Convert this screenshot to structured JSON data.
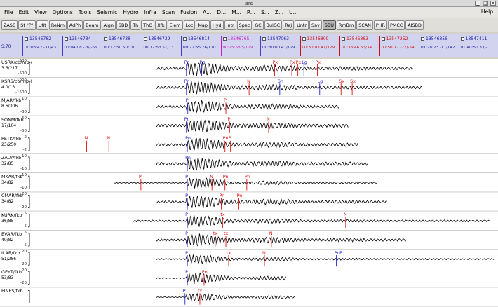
{
  "window": {
    "title": "ars"
  },
  "menu": [
    "File",
    "Edit",
    "View",
    "Options",
    "Tools",
    "Seismic",
    "Hydro",
    "Infra",
    "Scan",
    "Fusion",
    "A...",
    "D...",
    "M...",
    "R...",
    "S...",
    "Z...",
    "U..."
  ],
  "menu_help": "Help",
  "toolbar": [
    "ZASC",
    "St \"P\"",
    "Ufit",
    "ReNm",
    "AdPh",
    "Beam",
    "Algn",
    "SBD",
    "Th",
    "ThO",
    "Xfk",
    "Elem",
    "Loc",
    "Map",
    "Hyd",
    "Intr",
    "Spec",
    "GC",
    "BulGC",
    "Rej",
    "Untr",
    "Sav",
    "SBU",
    "RmBm",
    "SCAN",
    "PHR",
    "PMCC",
    "AISBD"
  ],
  "toolbar_active": "SBU",
  "event_strip": {
    "left_label": "S:70",
    "events": [
      {
        "id": "13546782",
        "time": "00:03:42 -31/43",
        "color": "blue"
      },
      {
        "id": "13546734",
        "time": "00:04:08 -26/-66",
        "color": "blue"
      },
      {
        "id": "13546738",
        "time": "00:12:50 50/10",
        "color": "blue"
      },
      {
        "id": "13546739",
        "time": "00:12:53 51/13",
        "color": "blue"
      },
      {
        "id": "13546814",
        "time": "00:22:55 76/110",
        "color": "blue"
      },
      {
        "id": "13546765",
        "time": "00:25:58 5/129",
        "color": "magenta"
      },
      {
        "id": "13547063",
        "time": "00:30:00 41/129",
        "color": "blue"
      },
      {
        "id": "13546809",
        "time": "00:30:03 41/129",
        "color": "red"
      },
      {
        "id": "13546863",
        "time": "00:38:46 53/34",
        "color": "red"
      },
      {
        "id": "13547252",
        "time": "00:50:17 -27/-54",
        "color": "red"
      },
      {
        "id": "13546856",
        "time": "01:28:23 -11/142",
        "color": "blue"
      },
      {
        "id": "13547411",
        "time": "01:40:50 33/-",
        "color": "blue"
      }
    ]
  },
  "channels": [
    {
      "name": "USRK/cb/mp-(",
      "sub": "3.6/217",
      "scale_top": "500",
      "scale_bot": "-500",
      "amp": 1.0,
      "start": 0.27,
      "noise": 0.18
    },
    {
      "name": "KSRS/cb/mp-(",
      "sub": "4.0/13",
      "scale_top": "1000",
      "scale_bot": "-1500",
      "amp": 0.9,
      "start": 0.27,
      "noise": 0.16
    },
    {
      "name": "MJAR/fkb",
      "sub": "8.6/306",
      "scale_top": "10",
      "scale_bot": "-30",
      "amp": 0.8,
      "start": 0.27,
      "noise": 0.15
    },
    {
      "name": "SONM/fkb",
      "sub": "17/104",
      "scale_top": "50",
      "scale_bot": "-50",
      "amp": 0.9,
      "start": 0.27,
      "noise": 0.18
    },
    {
      "name": "PETK/fkb",
      "sub": "23/250",
      "scale_top": "2",
      "scale_bot": "-2",
      "amp": 0.9,
      "start": 0.27,
      "noise": 0.15
    },
    {
      "name": "ZALV/fkb",
      "sub": "32/85",
      "scale_top": "10",
      "scale_bot": "-10",
      "amp": 0.8,
      "start": 0.27,
      "noise": 0.18
    },
    {
      "name": "MKAR/fkb",
      "sub": "34/82",
      "scale_top": "10",
      "scale_bot": "-10",
      "amp": 0.85,
      "start": 0.18,
      "noise": 0.06
    },
    {
      "name": "CMAR/fkb",
      "sub": "34/82",
      "scale_top": "20",
      "scale_bot": "-20",
      "amp": 0.9,
      "start": 0.27,
      "noise": 0.14
    },
    {
      "name": "KURK/fkb",
      "sub": "36/85",
      "scale_top": "5",
      "scale_bot": "-5",
      "amp": 0.8,
      "start": 0.22,
      "noise": 0.12
    },
    {
      "name": "BVAR/fkb",
      "sub": "40/82",
      "scale_top": "5",
      "scale_bot": "-5",
      "amp": 0.85,
      "start": 0.27,
      "noise": 0.16
    },
    {
      "name": "ILAR/fkb",
      "sub": "51/286",
      "scale_top": "20",
      "scale_bot": "-20",
      "amp": 0.7,
      "start": 0.27,
      "noise": 0.08
    },
    {
      "name": "GEYT/fkb",
      "sub": "53/83",
      "scale_top": "20",
      "scale_bot": "-20",
      "amp": 0.8,
      "start": 0.27,
      "noise": 0.07
    },
    {
      "name": "FINES/fkb",
      "sub": "",
      "scale_top": "",
      "scale_bot": "",
      "amp": 0.6,
      "start": 0.27,
      "noise": 0.05
    }
  ],
  "phases": [
    {
      "ch": 0,
      "label": "Pn",
      "t": 0.335,
      "color": "blue"
    },
    {
      "ch": 0,
      "label": "Pg",
      "t": 0.368,
      "color": "blue"
    },
    {
      "ch": 0,
      "label": "Px",
      "t": 0.525,
      "color": "red"
    },
    {
      "ch": 0,
      "label": "Px",
      "t": 0.562,
      "color": "red"
    },
    {
      "ch": 0,
      "label": "Px",
      "t": 0.575,
      "color": "red"
    },
    {
      "ch": 0,
      "label": "Lg",
      "t": 0.588,
      "color": "blue"
    },
    {
      "ch": 0,
      "label": "Px",
      "t": 0.617,
      "color": "red"
    },
    {
      "ch": 1,
      "label": "Pn",
      "t": 0.335,
      "color": "blue"
    },
    {
      "ch": 1,
      "label": "N",
      "t": 0.47,
      "color": "red"
    },
    {
      "ch": 1,
      "label": "Sn",
      "t": 0.536,
      "color": "blue"
    },
    {
      "ch": 1,
      "label": "Lg",
      "t": 0.622,
      "color": "blue"
    },
    {
      "ch": 1,
      "label": "Sx",
      "t": 0.668,
      "color": "red"
    },
    {
      "ch": 1,
      "label": "Sx",
      "t": 0.692,
      "color": "red"
    },
    {
      "ch": 2,
      "label": "P",
      "t": 0.338,
      "color": "blue"
    },
    {
      "ch": 2,
      "label": "P",
      "t": 0.42,
      "color": "red"
    },
    {
      "ch": 3,
      "label": "Pn",
      "t": 0.335,
      "color": "blue"
    },
    {
      "ch": 3,
      "label": "P",
      "t": 0.428,
      "color": "red"
    },
    {
      "ch": 3,
      "label": "N",
      "t": 0.512,
      "color": "red"
    },
    {
      "ch": 4,
      "label": "N",
      "t": 0.12,
      "color": "red"
    },
    {
      "ch": 4,
      "label": "N",
      "t": 0.168,
      "color": "red"
    },
    {
      "ch": 4,
      "label": "Pn",
      "t": 0.337,
      "color": "blue"
    },
    {
      "ch": 4,
      "label": "Pn",
      "t": 0.418,
      "color": "red"
    },
    {
      "ch": 4,
      "label": "P",
      "t": 0.43,
      "color": "red"
    },
    {
      "ch": 5,
      "label": "Pn",
      "t": 0.337,
      "color": "blue"
    },
    {
      "ch": 6,
      "label": "P",
      "t": 0.237,
      "color": "red"
    },
    {
      "ch": 6,
      "label": "P",
      "t": 0.337,
      "color": "blue"
    },
    {
      "ch": 6,
      "label": "N",
      "t": 0.39,
      "color": "red"
    },
    {
      "ch": 6,
      "label": "Pn",
      "t": 0.418,
      "color": "red"
    },
    {
      "ch": 6,
      "label": "Pn",
      "t": 0.465,
      "color": "red"
    },
    {
      "ch": 7,
      "label": "P",
      "t": 0.337,
      "color": "blue"
    },
    {
      "ch": 7,
      "label": "Pn",
      "t": 0.41,
      "color": "red"
    },
    {
      "ch": 7,
      "label": "Pn",
      "t": 0.448,
      "color": "red"
    },
    {
      "ch": 8,
      "label": "P",
      "t": 0.337,
      "color": "blue"
    },
    {
      "ch": 8,
      "label": "tx",
      "t": 0.413,
      "color": "red"
    },
    {
      "ch": 8,
      "label": "N",
      "t": 0.678,
      "color": "red"
    },
    {
      "ch": 9,
      "label": "P",
      "t": 0.337,
      "color": "blue"
    },
    {
      "ch": 9,
      "label": "tx",
      "t": 0.397,
      "color": "red"
    },
    {
      "ch": 9,
      "label": "tx",
      "t": 0.42,
      "color": "red"
    },
    {
      "ch": 9,
      "label": "N",
      "t": 0.518,
      "color": "red"
    },
    {
      "ch": 10,
      "label": "P",
      "t": 0.337,
      "color": "blue"
    },
    {
      "ch": 10,
      "label": "tx",
      "t": 0.426,
      "color": "red"
    },
    {
      "ch": 10,
      "label": "N",
      "t": 0.503,
      "color": "red"
    },
    {
      "ch": 10,
      "label": "PcP",
      "t": 0.658,
      "color": "blue"
    },
    {
      "ch": 11,
      "label": "P",
      "t": 0.337,
      "color": "blue"
    },
    {
      "ch": 11,
      "label": "Pn",
      "t": 0.373,
      "color": "red"
    },
    {
      "ch": 12,
      "label": "P",
      "t": 0.332,
      "color": "blue"
    },
    {
      "ch": 12,
      "label": "tx",
      "t": 0.364,
      "color": "red"
    }
  ],
  "colors": {
    "trace": "#000000",
    "phase_blue": "#2020d0",
    "phase_red": "#e01010",
    "strip_bg": "#d2d4ef",
    "toolbar_bg": "#e0ded8"
  }
}
